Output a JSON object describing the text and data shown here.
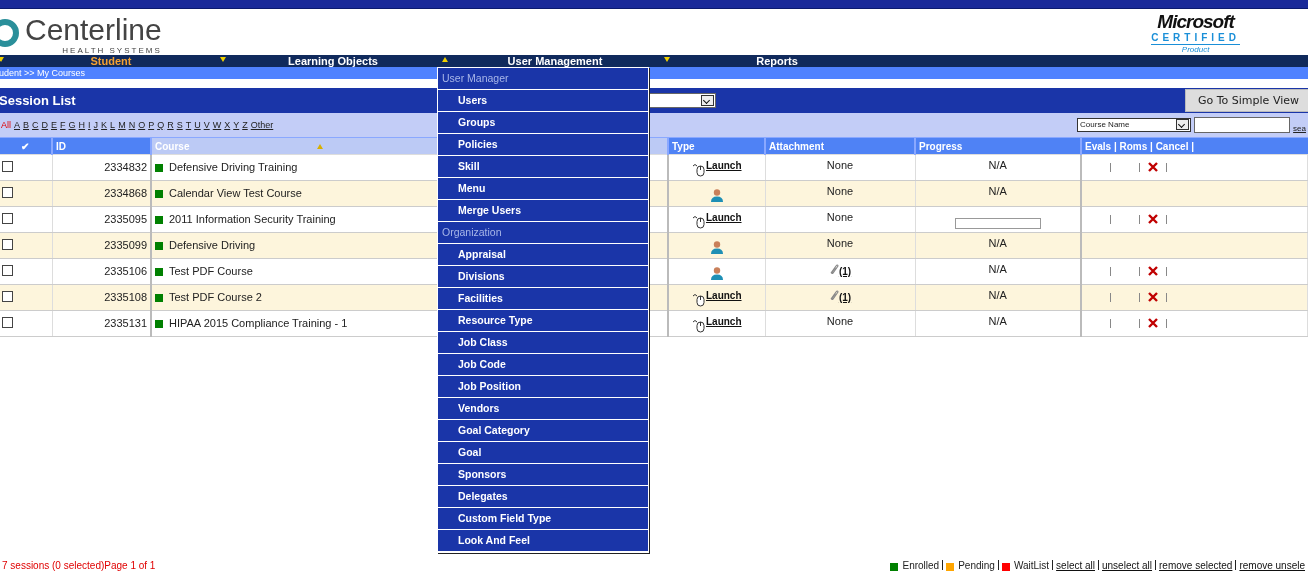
{
  "logo": {
    "name": "Centerline",
    "subtitle": "HEALTH SYSTEMS"
  },
  "certification": {
    "brand": "Microsoft",
    "line": "CERTIFIED",
    "sub": "Product"
  },
  "nav": [
    {
      "label": "Student",
      "selected": true,
      "expanded": false
    },
    {
      "label": "Learning Objects",
      "selected": false,
      "expanded": false
    },
    {
      "label": "User Management",
      "selected": false,
      "expanded": true
    },
    {
      "label": "Reports",
      "selected": false,
      "expanded": false
    }
  ],
  "breadcrumb": "udent >> My Courses",
  "title": "Session List",
  "simple_view_button": "Go To Simple View",
  "letters": [
    {
      "label": "All",
      "selected": true
    },
    {
      "label": "A",
      "selected": false
    },
    {
      "label": "B",
      "selected": false
    },
    {
      "label": "C",
      "selected": false
    },
    {
      "label": "D",
      "selected": false
    },
    {
      "label": "E",
      "selected": false
    },
    {
      "label": "F",
      "selected": false
    },
    {
      "label": "G",
      "selected": false
    },
    {
      "label": "H",
      "selected": false
    },
    {
      "label": "I",
      "selected": false
    },
    {
      "label": "J",
      "selected": false
    },
    {
      "label": "K",
      "selected": false
    },
    {
      "label": "L",
      "selected": false
    },
    {
      "label": "M",
      "selected": false
    },
    {
      "label": "N",
      "selected": false
    },
    {
      "label": "O",
      "selected": false
    },
    {
      "label": "P",
      "selected": false
    },
    {
      "label": "Q",
      "selected": false
    },
    {
      "label": "R",
      "selected": false
    },
    {
      "label": "S",
      "selected": false
    },
    {
      "label": "T",
      "selected": false
    },
    {
      "label": "U",
      "selected": false
    },
    {
      "label": "V",
      "selected": false
    },
    {
      "label": "W",
      "selected": false
    },
    {
      "label": "X",
      "selected": false
    },
    {
      "label": "Y",
      "selected": false
    },
    {
      "label": "Z",
      "selected": false
    },
    {
      "label": "Other",
      "selected": false
    }
  ],
  "search": {
    "field": "Course Name",
    "link": "sea"
  },
  "table": {
    "columns": [
      "✔",
      "ID",
      "Course",
      "Type",
      "Attachment",
      "Progress",
      "Evals | Roms | Cancel |"
    ],
    "rows": [
      {
        "checked": false,
        "id": "2334832",
        "course": "Defensive Driving Training",
        "color": "#008000",
        "type": {
          "kind": "launch",
          "text": "Launch"
        },
        "attachment": {
          "kind": "none",
          "text": "None"
        },
        "progress": {
          "kind": "text",
          "text": "N/A"
        },
        "actions": true
      },
      {
        "checked": false,
        "id": "2334868",
        "course": "Calendar View Test Course",
        "color": "#008000",
        "type": {
          "kind": "person"
        },
        "attachment": {
          "kind": "none",
          "text": "None"
        },
        "progress": {
          "kind": "text",
          "text": "N/A"
        },
        "actions": false
      },
      {
        "checked": false,
        "id": "2335095",
        "course": "2011 Information Security Training",
        "color": "#008000",
        "type": {
          "kind": "launch",
          "text": "Launch"
        },
        "attachment": {
          "kind": "none",
          "text": "None"
        },
        "progress": {
          "kind": "bar",
          "level": 0
        },
        "actions": true
      },
      {
        "checked": false,
        "id": "2335099",
        "course": "Defensive Driving",
        "color": "#008000",
        "type": {
          "kind": "person"
        },
        "attachment": {
          "kind": "none",
          "text": "None"
        },
        "progress": {
          "kind": "text",
          "text": "N/A"
        },
        "actions": false
      },
      {
        "checked": false,
        "id": "2335106",
        "course": "Test PDF Course",
        "color": "#008000",
        "type": {
          "kind": "person"
        },
        "attachment": {
          "kind": "file",
          "text": "(1)"
        },
        "progress": {
          "kind": "text",
          "text": "N/A"
        },
        "actions": true
      },
      {
        "checked": false,
        "id": "2335108",
        "course": "Test PDF Course 2",
        "color": "#008000",
        "type": {
          "kind": "launch",
          "text": "Launch"
        },
        "attachment": {
          "kind": "file",
          "text": "(1)"
        },
        "progress": {
          "kind": "text",
          "text": "N/A"
        },
        "actions": true
      },
      {
        "checked": false,
        "id": "2335131",
        "course": "HIPAA 2015 Compliance Training - 1",
        "color": "#008000",
        "type": {
          "kind": "launch",
          "text": "Launch"
        },
        "attachment": {
          "kind": "none",
          "text": "None"
        },
        "progress": {
          "kind": "text",
          "text": "N/A"
        },
        "actions": true
      }
    ]
  },
  "menu": [
    {
      "header": "User Manager",
      "items": [
        "Users",
        "Groups",
        "Policies",
        "Skill",
        "Menu",
        "Merge Users"
      ]
    },
    {
      "header": "Organization",
      "items": [
        "Appraisal",
        "Divisions",
        "Facilities",
        "Resource Type",
        "Job Class",
        "Job Code",
        "Job Position",
        "Vendors",
        "Goal Category",
        "Goal",
        "Sponsors",
        "Delegates",
        "Custom Field Type",
        "Look And Feel"
      ]
    }
  ],
  "footer": {
    "summary": "7 sessions (0 selected)Page 1 of 1",
    "legend": [
      {
        "label": "Enrolled",
        "color": "#008000"
      },
      {
        "label": "Pending",
        "color": "#ffa500"
      },
      {
        "label": "WaitList",
        "color": "#ff0000"
      }
    ],
    "links": [
      "select all",
      "unselect all",
      "remove selected",
      "remove unsele"
    ]
  }
}
